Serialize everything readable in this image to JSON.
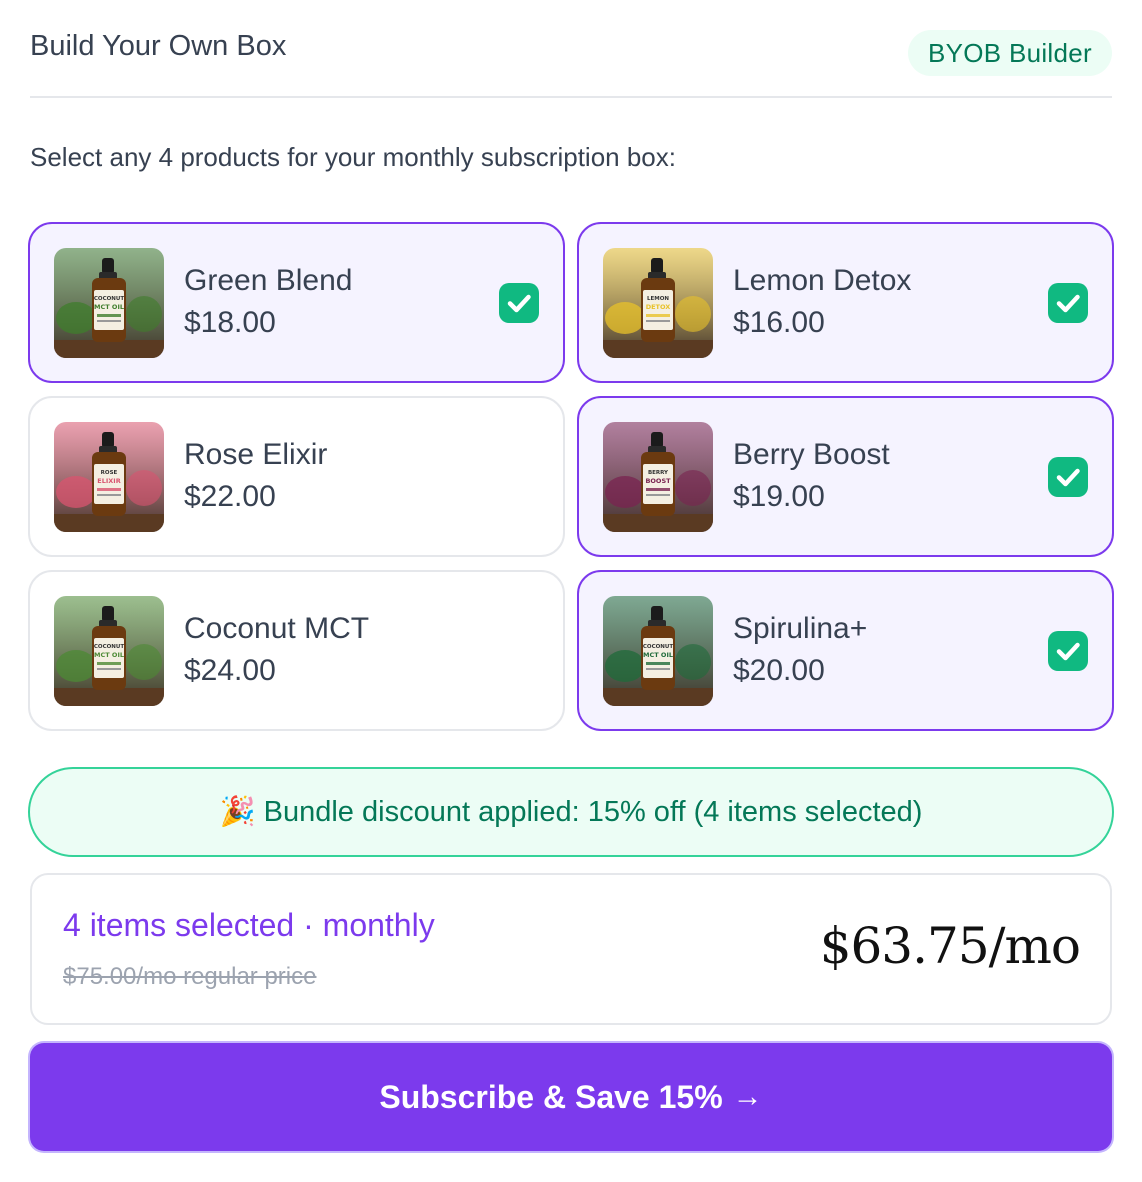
{
  "header": {
    "title": "Build Your Own Box",
    "badge": "BYOB Builder"
  },
  "instructions": "Select any 4 products for your monthly subscription box:",
  "products": [
    {
      "name": "Green Blend",
      "price": "$18.00",
      "selected": true,
      "image": "green-blend-bottle",
      "label_lines": [
        "COCONUT",
        "MCT OIL"
      ],
      "accent": "#3f7d2c"
    },
    {
      "name": "Lemon Detox",
      "price": "$16.00",
      "selected": true,
      "image": "lemon-detox-bottle",
      "label_lines": [
        "LEMON",
        "DETOX"
      ],
      "accent": "#e8c22a"
    },
    {
      "name": "Rose Elixir",
      "price": "$22.00",
      "selected": false,
      "image": "rose-elixir-bottle",
      "label_lines": [
        "ROSE",
        "ELIXIR"
      ],
      "accent": "#d9546f"
    },
    {
      "name": "Berry Boost",
      "price": "$19.00",
      "selected": true,
      "image": "berry-boost-bottle",
      "label_lines": [
        "BERRY",
        "BOOST"
      ],
      "accent": "#7a2350"
    },
    {
      "name": "Coconut MCT",
      "price": "$24.00",
      "selected": false,
      "image": "coconut-mct-bottle",
      "label_lines": [
        "COCONUT",
        "MCT OIL"
      ],
      "accent": "#4c8a34"
    },
    {
      "name": "Spirulina+",
      "price": "$20.00",
      "selected": true,
      "image": "spirulina-bottle",
      "label_lines": [
        "COCONUT",
        "MCT OIL"
      ],
      "accent": "#1f6b3a"
    }
  ],
  "discount": {
    "emoji": "🎉",
    "text": "Bundle discount applied: 15% off (4 items selected)"
  },
  "summary": {
    "selection_line": "4 items selected · monthly",
    "regular_price": "$75.00/mo regular price",
    "total": "$63.75/mo"
  },
  "cta": {
    "label": "Subscribe & Save 15%",
    "arrow": "→"
  },
  "colors": {
    "accent": "#7c3aed",
    "accent_light": "#f5f3ff",
    "success": "#10b981",
    "success_bg": "#ecfdf5",
    "success_text": "#047857"
  }
}
